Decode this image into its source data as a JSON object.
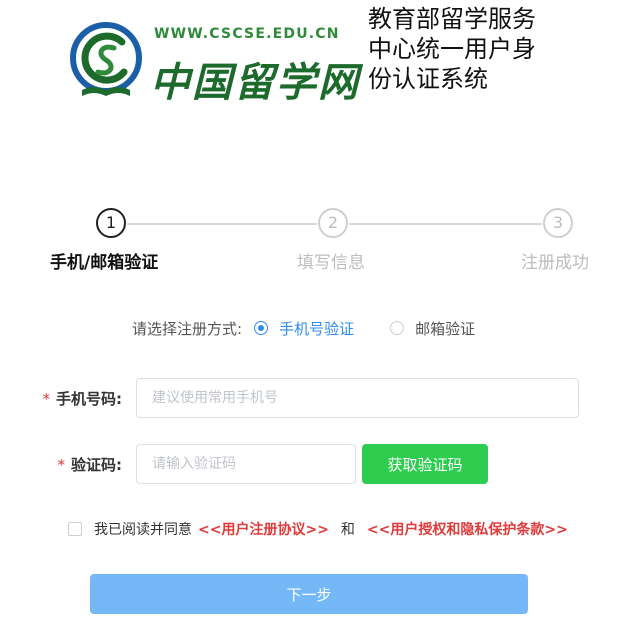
{
  "header": {
    "logo_url": "WWW.CSCSE.EDU.CN",
    "logo_name": "中国留学网",
    "system_title": "教育部留学服务中心统一用户身份认证系统",
    "logo_colors": {
      "green": "#1c6a2c",
      "blue": "#1b5fa6",
      "light_green": "#2f8a3a"
    }
  },
  "steps": [
    {
      "number": "1",
      "label": "手机/邮箱验证",
      "active": true
    },
    {
      "number": "2",
      "label": "填写信息",
      "active": false
    },
    {
      "number": "3",
      "label": "注册成功",
      "active": false
    }
  ],
  "method": {
    "label": "请选择注册方式:",
    "options": [
      {
        "label": "手机号验证",
        "checked": true
      },
      {
        "label": "邮箱验证",
        "checked": false
      }
    ]
  },
  "form": {
    "phone": {
      "required_mark": "*",
      "label": "手机号码:",
      "value": "",
      "placeholder": "建议使用常用手机号"
    },
    "code": {
      "required_mark": "*",
      "label": "验证码:",
      "value": "",
      "placeholder": "请输入验证码"
    },
    "get_code_label": "获取验证码"
  },
  "agreement": {
    "checked": false,
    "text": "我已阅读并同意",
    "link1": "<<用户注册协议>>",
    "and": "和",
    "link2": "<<用户授权和隐私保护条款>>"
  },
  "next_label": "下一步",
  "colors": {
    "primary_blue": "#2d8cf0",
    "next_button": "#74b8f7",
    "get_code_button": "#2ecc4f",
    "required_red": "#e03a3a"
  }
}
